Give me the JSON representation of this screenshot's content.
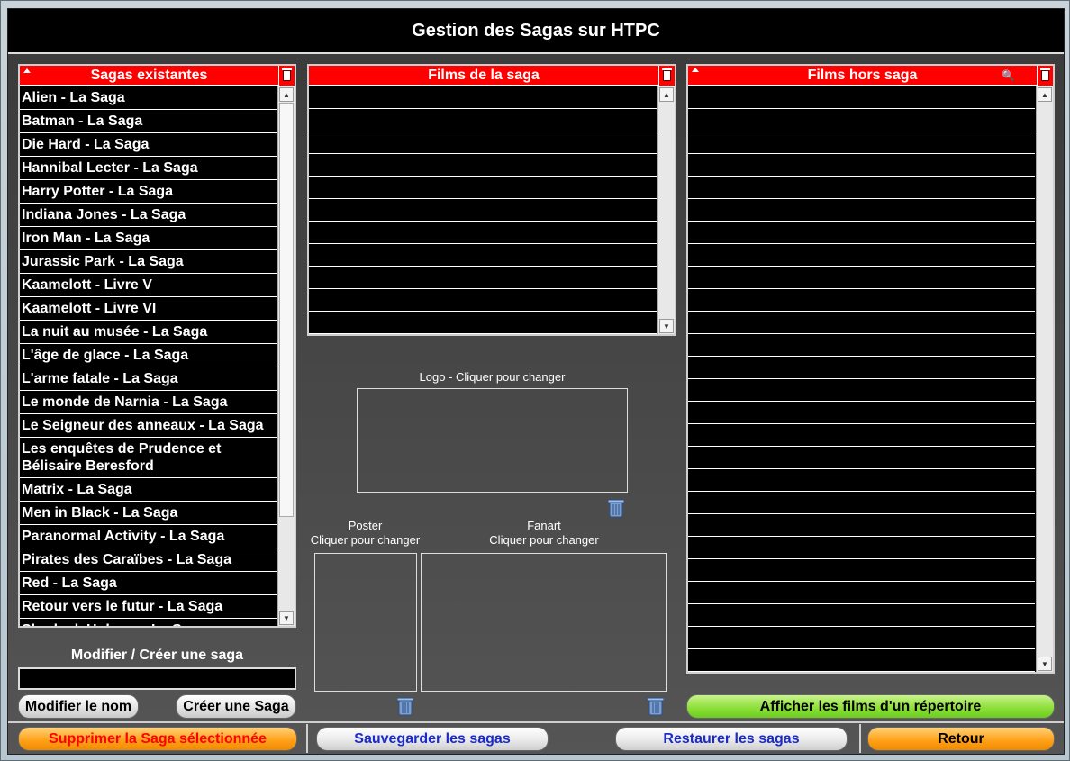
{
  "window": {
    "title": "Gestion des Sagas sur HTPC"
  },
  "sagas_panel": {
    "header": "Sagas existantes",
    "items": [
      "Alien - La Saga",
      "Batman - La Saga",
      "Die Hard - La Saga",
      "Hannibal Lecter - La Saga",
      "Harry Potter - La Saga",
      "Indiana Jones - La Saga",
      "Iron Man - La Saga",
      "Jurassic Park - La Saga",
      "Kaamelott - Livre V",
      "Kaamelott - Livre VI",
      "La nuit au musée - La Saga",
      "L'âge de glace - La Saga",
      "L'arme fatale - La Saga",
      "Le monde de Narnia - La Saga",
      "Le Seigneur des anneaux - La Saga",
      "Les enquêtes de Prudence et Bélisaire Beresford",
      "Matrix - La Saga",
      "Men in Black - La Saga",
      "Paranormal Activity - La Saga",
      "Pirates des Caraïbes - La Saga",
      "Red - La Saga",
      "Retour vers le futur - La Saga",
      "Sherlock Holmes - La Saga"
    ]
  },
  "films_saga_panel": {
    "header": "Films de la saga",
    "row_count": 11
  },
  "films_hors_panel": {
    "header": "Films hors saga",
    "row_count": 26
  },
  "images": {
    "logo_label": "Logo - Cliquer pour changer",
    "poster_label_1": "Poster",
    "poster_label_2": "Cliquer pour changer",
    "fanart_label_1": "Fanart",
    "fanart_label_2": "Cliquer pour changer"
  },
  "edit_saga": {
    "label": "Modifier / Créer une saga",
    "input_value": "",
    "rename_button": "Modifier le nom",
    "create_button": "Créer une Saga"
  },
  "buttons": {
    "show_folder_films": "Afficher les films d'un répertoire",
    "delete_saga": "Supprimer la Saga sélectionnée",
    "save_sagas": "Sauvegarder les sagas",
    "restore_sagas": "Restaurer les sagas",
    "back": "Retour"
  },
  "colors": {
    "header_red": "#ff0000",
    "delete_text": "#ff0000",
    "save_text": "#1a2acb",
    "green_button": "#8fe03a",
    "orange_button": "#ffa21a"
  },
  "icons": [
    "trash-icon",
    "sort-arrow-icon",
    "magnifier-icon",
    "scroll-up-icon",
    "scroll-down-icon"
  ]
}
